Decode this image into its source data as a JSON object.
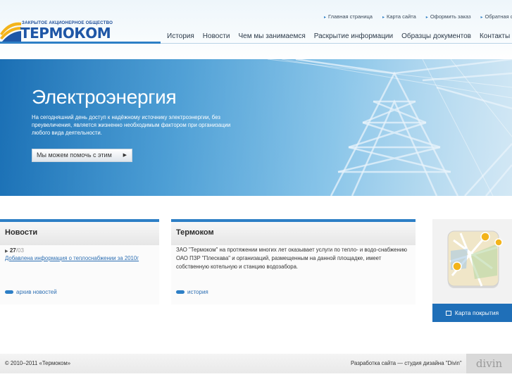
{
  "brand": {
    "subtitle": "ЗАКРЫТОЕ АКЦИОНЕРНОЕ ОБЩЕСТВО",
    "name": "ТЕРМОКОМ",
    "color": "#1e56a6",
    "accent": "#2d7fc6"
  },
  "toplinks": [
    {
      "label": "Главная страница",
      "icon": "bullet-arrow-icon"
    },
    {
      "label": "Карта сайта",
      "icon": "bullet-arrow-icon"
    },
    {
      "label": "Оформить заказ",
      "icon": "bullet-arrow-icon"
    },
    {
      "label": "Обратная связь",
      "icon": "bullet-arrow-icon"
    }
  ],
  "nav": [
    "История",
    "Новости",
    "Чем мы занимаемся",
    "Раскрытие информации",
    "Образцы документов",
    "Контакты"
  ],
  "banner": {
    "title": "Электроэнергия",
    "text": "На сегодняшний день доступ к надёжному источнику электроэнергии, без преувеличения, является жизненно необходимым фактором при организации любого вида деятельности.",
    "button": "Мы можем помочь с этим"
  },
  "news": {
    "title": "Новости",
    "day": "27",
    "month": "03",
    "link": "Добавлена информация о теплоснабжении за 2010г",
    "archive": "архив новостей"
  },
  "about": {
    "title": "Термоком",
    "text": "ЗАО \"Термоком\" на протяжении многих лет оказывает услуги по тепло- и водо-снабжению ОАО ПЗР \"Плескава\" и организаций, размещенным на данной площадке, имеет собственную котельную и станцию водозабора.",
    "link": "история"
  },
  "map": {
    "button": "Карта покрытия",
    "icon": "map-icon"
  },
  "footer": {
    "copyright": "© 2010–2011 «Термоком»",
    "developer": "Разработка сайта — студия дизайна \"Divin\"",
    "logo": "divin"
  }
}
